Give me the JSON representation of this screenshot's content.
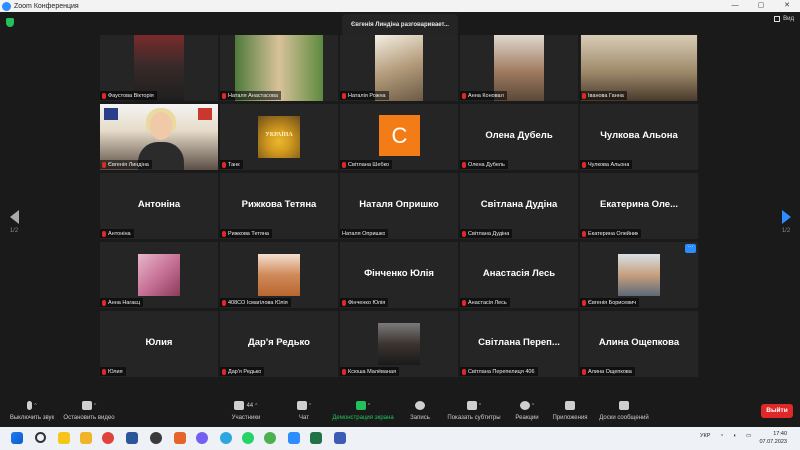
{
  "window": {
    "title": "Zoom Конференция",
    "controls": [
      "—",
      "▢",
      "✕"
    ]
  },
  "meeting": {
    "speaker_toast": "Євгенія Линдіна разговаривает...",
    "view_label": "Вид",
    "page_left": "1/2",
    "page_right": "1/2"
  },
  "tiles": [
    {
      "label": "Фаустова Вікторія",
      "kind": "photo",
      "photo": "p1"
    },
    {
      "label": "Наталя Анастасова",
      "kind": "photo",
      "photo": "p2"
    },
    {
      "label": "Наталія Рожна",
      "kind": "photo",
      "photo": "p3"
    },
    {
      "label": "Анна Коновал",
      "kind": "photo",
      "photo": "p4"
    },
    {
      "label": "Іванова Ганна",
      "kind": "photo",
      "photo": "p5"
    },
    {
      "label": "Євгенія Линдіна",
      "kind": "active"
    },
    {
      "label": "Танк",
      "kind": "sun",
      "image_text": "УКРАЇНА"
    },
    {
      "label": "Світлана Шебко",
      "kind": "avatar",
      "letter": "С"
    },
    {
      "label": "Олена Дубель",
      "kind": "name",
      "display": "Олена Дубель"
    },
    {
      "label": "Чулкова Альона",
      "kind": "name",
      "display": "Чулкова Альона"
    },
    {
      "label": "Антоніна",
      "kind": "name",
      "display": "Антоніна"
    },
    {
      "label": "Рижкова Тетяна",
      "kind": "name",
      "display": "Рижкова Тетяна"
    },
    {
      "label": "Наталя Опришко",
      "kind": "name",
      "display": "Наталя Опришко",
      "nomic": true
    },
    {
      "label": "Світлана Дудіна",
      "kind": "name",
      "display": "Світлана Дудіна"
    },
    {
      "label": "Екатерина Олейник",
      "kind": "name",
      "display": "Екатерина Оле..."
    },
    {
      "label": "Анна Нагаєц",
      "kind": "photo-small",
      "photo": "p7"
    },
    {
      "label": "408СО Ісмагілова Юлія",
      "kind": "photo-small",
      "photo": "p8"
    },
    {
      "label": "Фінченко Юлія",
      "kind": "name",
      "display": "Фінченко Юлія"
    },
    {
      "label": "Анастасія Лесь",
      "kind": "name",
      "display": "Анастасія Лесь"
    },
    {
      "label": "Євгенія Борисевич",
      "kind": "photo-small",
      "photo": "p9",
      "more": true
    },
    {
      "label": "Юлия",
      "kind": "name",
      "display": "Юлия"
    },
    {
      "label": "Дар'я Редько",
      "kind": "name",
      "display": "Дар'я Редько"
    },
    {
      "label": "Ксюша Малёваная",
      "kind": "photo-small",
      "photo": "p10"
    },
    {
      "label": "Світлана Перепелиця 406",
      "kind": "name",
      "display": "Світлана Переп..."
    },
    {
      "label": "Алина Ощепкова",
      "kind": "name",
      "display": "Алина Ощепкова"
    }
  ],
  "toolbar": {
    "mute": "Выключить звук",
    "video": "Остановить видео",
    "participants": "Участники",
    "participants_count": "44",
    "chat": "Чат",
    "share": "Демонстрация экрана",
    "record": "Запись",
    "captions": "Показать субтитры",
    "reactions": "Реакции",
    "apps": "Приложения",
    "whiteboards": "Доски сообщений",
    "leave": "Выйти"
  },
  "taskbar": {
    "lang": "УКР",
    "time": "17:40",
    "date": "07.07.2023"
  }
}
